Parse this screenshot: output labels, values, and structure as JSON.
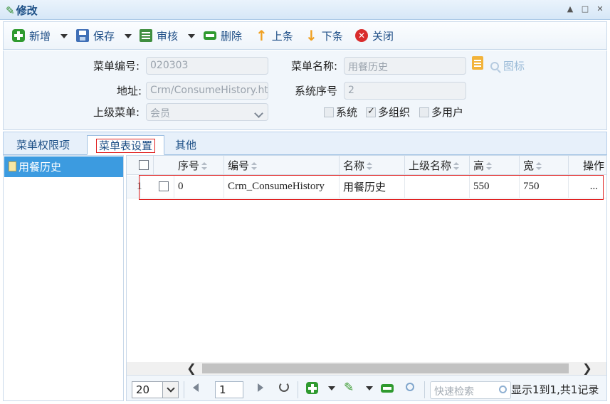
{
  "window": {
    "title": "修改",
    "controls": [
      "▲",
      "□",
      "✕"
    ]
  },
  "toolbar": {
    "add": "新增",
    "save": "保存",
    "audit": "审核",
    "delete": "删除",
    "prev": "上条",
    "next": "下条",
    "close": "关闭"
  },
  "form": {
    "menu_code_label": "菜单编号:",
    "menu_code_value": "020303",
    "menu_name_label": "菜单名称:",
    "menu_name_value": "用餐历史",
    "icon_label": "图标",
    "address_label": "地址:",
    "address_value": "Crm/ConsumeHistory.ht",
    "sys_order_label": "系统序号",
    "sys_order_value": "2",
    "parent_menu_label": "上级菜单:",
    "parent_menu_value": "会员",
    "chk_system_label": "系统",
    "chk_system_checked": false,
    "chk_multiorg_label": "多组织",
    "chk_multiorg_checked": true,
    "chk_multiuser_label": "多用户",
    "chk_multiuser_checked": false
  },
  "tabs": [
    {
      "label": "菜单权限项",
      "active": false
    },
    {
      "label": "菜单表设置",
      "active": true
    },
    {
      "label": "其他",
      "active": false
    }
  ],
  "tree": {
    "items": [
      {
        "label": "用餐历史",
        "selected": true
      }
    ]
  },
  "grid": {
    "columns": [
      "序号",
      "编号",
      "名称",
      "上级名称",
      "高",
      "宽",
      "操作"
    ],
    "rows": [
      {
        "rownum": "1",
        "seq": "0",
        "code": "Crm_ConsumeHistory",
        "name": "用餐历史",
        "parent": "",
        "height": "550",
        "width": "750",
        "action": "..."
      }
    ]
  },
  "pager": {
    "page_size": "20",
    "page": "1",
    "search_placeholder": "快速检索",
    "summary": "显示1到1,共1记录"
  }
}
